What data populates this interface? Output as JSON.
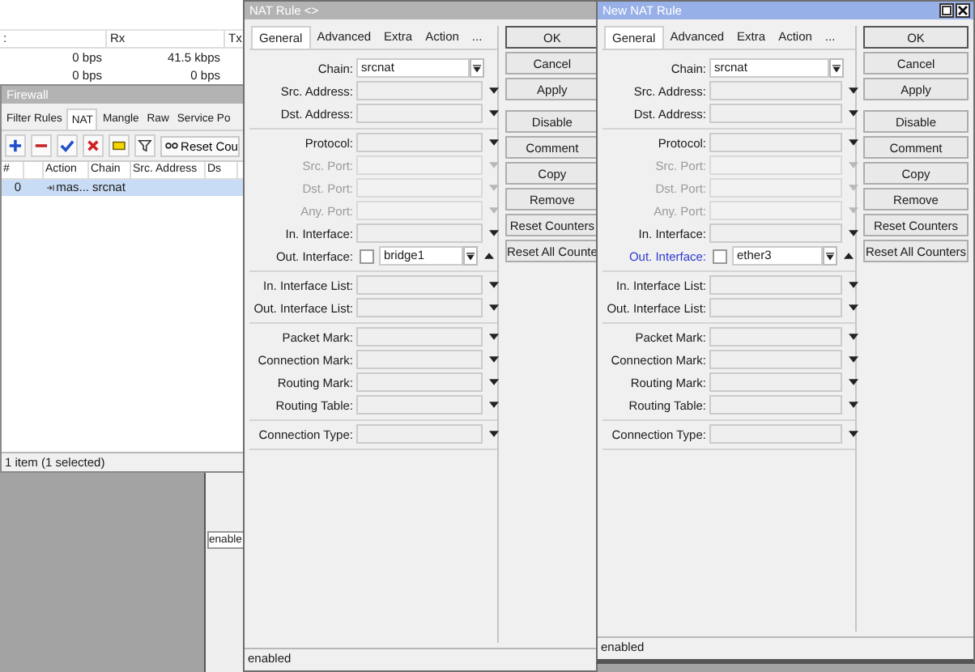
{
  "interface_list": {
    "columns": [
      ":",
      "Rx",
      "Tx"
    ],
    "rows": [
      {
        "cells": [
          "0 bps",
          "41.5 kbps"
        ]
      },
      {
        "cells": [
          "0 bps",
          "0 bps"
        ]
      }
    ]
  },
  "firewall": {
    "title": "Firewall",
    "tabs": [
      {
        "label": "Filter Rules",
        "selected": false
      },
      {
        "label": "NAT",
        "selected": true
      },
      {
        "label": "Mangle",
        "selected": false
      },
      {
        "label": "Raw",
        "selected": false
      },
      {
        "label": "Service Po",
        "selected": false
      }
    ],
    "reset_button": "Reset Cou",
    "columns": [
      "#",
      "Action",
      "Chain",
      "Src. Address",
      "Ds"
    ],
    "rows": [
      {
        "number": "0",
        "action": "mas...",
        "chain": "srcnat",
        "selected": true
      }
    ],
    "status": "1 item (1 selected)"
  },
  "small_window": {
    "status": "enable"
  },
  "rule_windows": [
    {
      "title": "NAT Rule <>",
      "active": false,
      "tabs": [
        {
          "label": "General",
          "selected": true
        },
        {
          "label": "Advanced",
          "selected": false
        },
        {
          "label": "Extra",
          "selected": false
        },
        {
          "label": "Action",
          "selected": false
        },
        {
          "label": "...",
          "selected": false
        }
      ],
      "sections": [
        {
          "fields": [
            {
              "label": "Chain:",
              "kind": "select",
              "value": "srcnat",
              "disabled": false,
              "highlighted": false
            },
            {
              "label": "Src. Address:",
              "kind": "dropdown",
              "disabled": false,
              "highlighted": false
            },
            {
              "label": "Dst. Address:",
              "kind": "dropdown",
              "disabled": false,
              "highlighted": false
            }
          ]
        },
        {
          "fields": [
            {
              "label": "Protocol:",
              "kind": "dropdown",
              "disabled": false,
              "highlighted": false
            },
            {
              "label": "Src. Port:",
              "kind": "dropdown",
              "disabled": true,
              "highlighted": false
            },
            {
              "label": "Dst. Port:",
              "kind": "dropdown",
              "disabled": true,
              "highlighted": false
            },
            {
              "label": "Any. Port:",
              "kind": "dropdown",
              "disabled": true,
              "highlighted": false
            },
            {
              "label": "In. Interface:",
              "kind": "dropdown",
              "disabled": false,
              "highlighted": false
            },
            {
              "label": "Out. Interface:",
              "kind": "interface",
              "value": "bridge1",
              "inverted": false,
              "disabled": false,
              "highlighted": false
            }
          ]
        },
        {
          "fields": [
            {
              "label": "In. Interface List:",
              "kind": "dropdown",
              "disabled": false,
              "highlighted": false
            },
            {
              "label": "Out. Interface List:",
              "kind": "dropdown",
              "disabled": false,
              "highlighted": false
            }
          ]
        },
        {
          "fields": [
            {
              "label": "Packet Mark:",
              "kind": "dropdown",
              "disabled": false,
              "highlighted": false
            },
            {
              "label": "Connection Mark:",
              "kind": "dropdown",
              "disabled": false,
              "highlighted": false
            },
            {
              "label": "Routing Mark:",
              "kind": "dropdown",
              "disabled": false,
              "highlighted": false
            },
            {
              "label": "Routing Table:",
              "kind": "dropdown",
              "disabled": false,
              "highlighted": false
            }
          ]
        },
        {
          "fields": [
            {
              "label": "Connection Type:",
              "kind": "dropdown",
              "disabled": false,
              "highlighted": false
            }
          ]
        }
      ],
      "buttons": [
        "OK",
        "Cancel",
        "Apply",
        "Disable",
        "Comment",
        "Copy",
        "Remove",
        "Reset Counters",
        "Reset All Counte"
      ],
      "status": "enabled"
    },
    {
      "title": "New NAT Rule",
      "active": true,
      "tabs": [
        {
          "label": "General",
          "selected": true
        },
        {
          "label": "Advanced",
          "selected": false
        },
        {
          "label": "Extra",
          "selected": false
        },
        {
          "label": "Action",
          "selected": false
        },
        {
          "label": "...",
          "selected": false
        }
      ],
      "sections": [
        {
          "fields": [
            {
              "label": "Chain:",
              "kind": "select",
              "value": "srcnat",
              "disabled": false,
              "highlighted": false
            },
            {
              "label": "Src. Address:",
              "kind": "dropdown",
              "disabled": false,
              "highlighted": false
            },
            {
              "label": "Dst. Address:",
              "kind": "dropdown",
              "disabled": false,
              "highlighted": false
            }
          ]
        },
        {
          "fields": [
            {
              "label": "Protocol:",
              "kind": "dropdown",
              "disabled": false,
              "highlighted": false
            },
            {
              "label": "Src. Port:",
              "kind": "dropdown",
              "disabled": true,
              "highlighted": false
            },
            {
              "label": "Dst. Port:",
              "kind": "dropdown",
              "disabled": true,
              "highlighted": false
            },
            {
              "label": "Any. Port:",
              "kind": "dropdown",
              "disabled": true,
              "highlighted": false
            },
            {
              "label": "In. Interface:",
              "kind": "dropdown",
              "disabled": false,
              "highlighted": false
            },
            {
              "label": "Out. Interface:",
              "kind": "interface",
              "value": "ether3",
              "inverted": false,
              "disabled": false,
              "highlighted": true
            }
          ]
        },
        {
          "fields": [
            {
              "label": "In. Interface List:",
              "kind": "dropdown",
              "disabled": false,
              "highlighted": false
            },
            {
              "label": "Out. Interface List:",
              "kind": "dropdown",
              "disabled": false,
              "highlighted": false
            }
          ]
        },
        {
          "fields": [
            {
              "label": "Packet Mark:",
              "kind": "dropdown",
              "disabled": false,
              "highlighted": false
            },
            {
              "label": "Connection Mark:",
              "kind": "dropdown",
              "disabled": false,
              "highlighted": false
            },
            {
              "label": "Routing Mark:",
              "kind": "dropdown",
              "disabled": false,
              "highlighted": false
            },
            {
              "label": "Routing Table:",
              "kind": "dropdown",
              "disabled": false,
              "highlighted": false
            }
          ]
        },
        {
          "fields": [
            {
              "label": "Connection Type:",
              "kind": "dropdown",
              "disabled": false,
              "highlighted": false
            }
          ]
        }
      ],
      "buttons": [
        "OK",
        "Cancel",
        "Apply",
        "Disable",
        "Comment",
        "Copy",
        "Remove",
        "Reset Counters",
        "Reset All Counters"
      ],
      "status": "enabled"
    }
  ]
}
